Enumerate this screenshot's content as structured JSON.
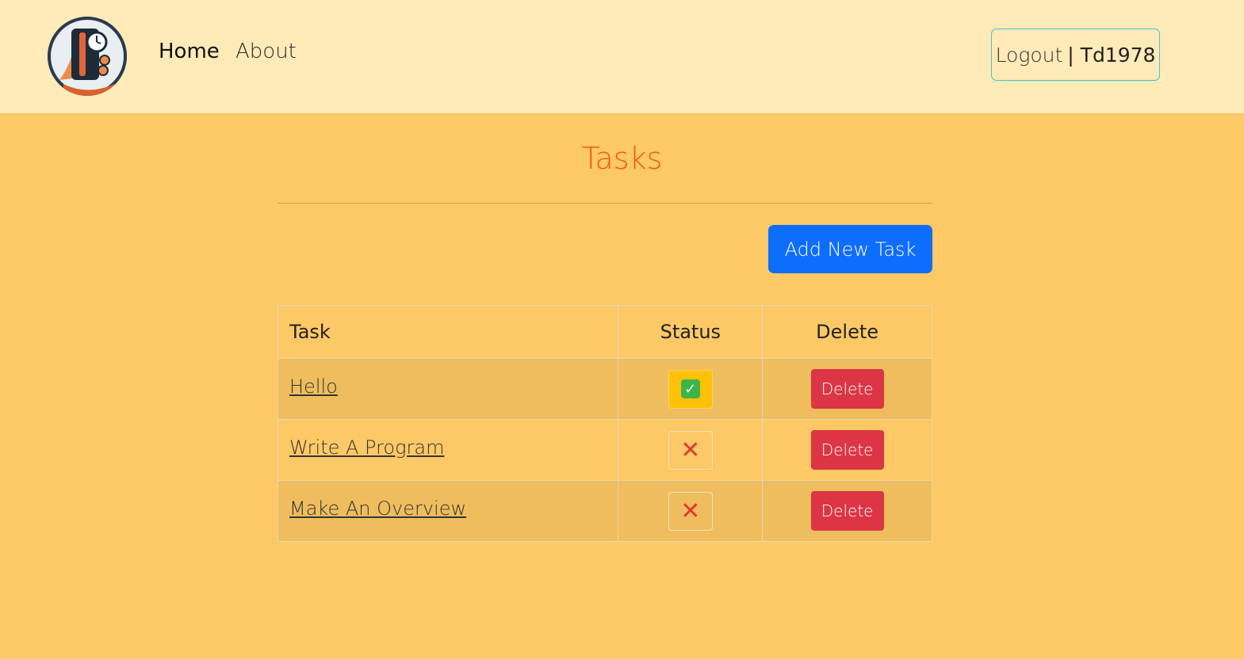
{
  "nav": {
    "home_label": "Home",
    "about_label": "About",
    "logout_label": "Logout",
    "user_label": "| Td1978"
  },
  "page": {
    "title": "Tasks",
    "add_button_label": "Add New Task"
  },
  "table": {
    "headers": {
      "task": "Task",
      "status": "Status",
      "delete": "Delete"
    },
    "rows": [
      {
        "task": "Hello",
        "status": "complete",
        "status_icon": "check-mark-icon",
        "delete_label": "Delete"
      },
      {
        "task": "Write A Program",
        "status": "incomplete",
        "status_icon": "cross-mark-icon",
        "delete_label": "Delete"
      },
      {
        "task": "Make An Overview",
        "status": "incomplete",
        "status_icon": "cross-mark-icon",
        "delete_label": "Delete"
      }
    ]
  },
  "colors": {
    "navbar_bg": "#ffeab8",
    "page_bg": "#fdc866",
    "title": "#f0581f",
    "primary_button": "#0d6efd",
    "danger_button": "#dc3545",
    "status_done_bg": "#ffc107"
  }
}
